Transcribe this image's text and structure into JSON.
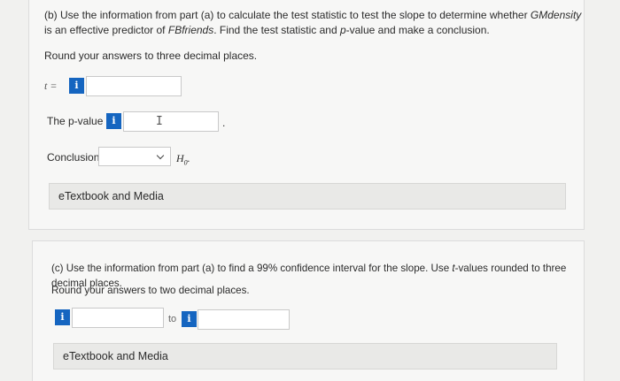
{
  "part_b": {
    "prompt_parts": {
      "p1": "(b) Use the information from part (a) to calculate the test statistic to test the slope to determine whether ",
      "var1": "GMdensity",
      "p2": " is an effective predictor of ",
      "var2": "FBfriends",
      "p3": ". Find the test statistic and ",
      "var3": "p",
      "p4": "-value and make a conclusion."
    },
    "round_note": "Round your answers to three decimal places.",
    "t_label": "t =",
    "t_value": "",
    "pvalue_label": "The p-value is",
    "pvalue_value": "",
    "pvalue_suffix": ".",
    "conclusion_label": "Conclusion:",
    "conclusion_selected": "",
    "h0_label": "H",
    "h0_sub": "0",
    "h0_suffix": ".",
    "info_glyph": "i",
    "etextbook": "eTextbook and Media"
  },
  "part_c": {
    "prompt_parts": {
      "p1": "(c) Use the information from part (a) to find a 99% confidence interval for the slope. Use ",
      "var1": "t",
      "p2": "-values rounded to three decimal places."
    },
    "round_note": "Round your answers to two decimal places.",
    "lower_value": "",
    "to_label": "to",
    "upper_value": "",
    "info_glyph": "i",
    "etextbook": "eTextbook and Media"
  },
  "colors": {
    "info_button": "#1565c0",
    "background": "#f1f1ef",
    "etextbook_bar": "#e9e9e7"
  }
}
